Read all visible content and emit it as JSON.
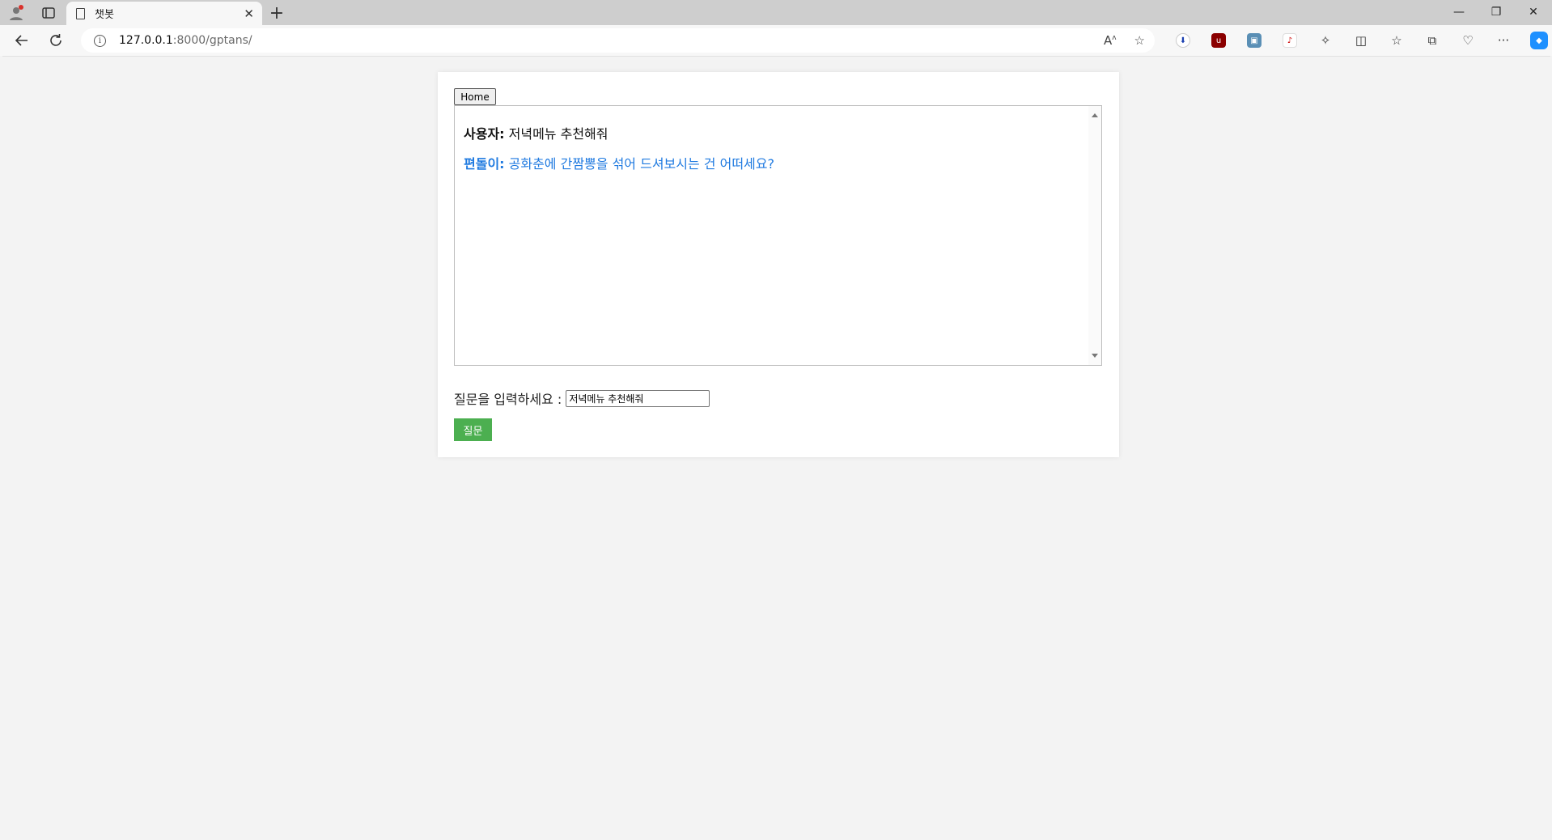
{
  "browser": {
    "tab_title": "챗봇",
    "tab_close": "✕",
    "new_tab": "+",
    "url_host": "127.0.0.1",
    "url_path": ":8000/gptans/",
    "window_controls": {
      "minimize": "—",
      "restore": "❐",
      "close": "✕"
    }
  },
  "page": {
    "home_button": "Home",
    "messages": [
      {
        "speaker": "사용자:",
        "text": " 저녁메뉴 추천해줘",
        "role": "user"
      },
      {
        "speaker": "편돌이:",
        "text": " 공화춘에 간짬뽕을 섞어 드셔보시는 건 어떠세요?",
        "role": "bot"
      }
    ],
    "ask_label": "질문을 입력하세요 :",
    "ask_input_value": "저녁메뉴 추천해줘",
    "ask_button": "질문"
  },
  "colors": {
    "bot_text": "#1f7ae0",
    "ask_button_bg": "#4caf50",
    "page_bg": "#f3f3f3"
  }
}
